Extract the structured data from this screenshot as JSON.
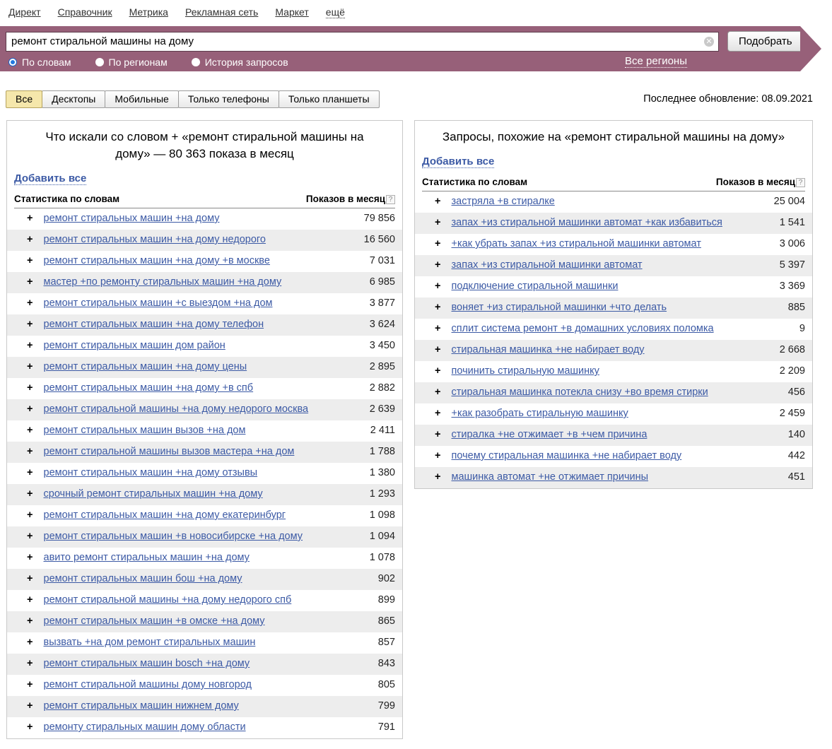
{
  "nav": {
    "items": [
      "Директ",
      "Справочник",
      "Метрика",
      "Рекламная сеть",
      "Маркет"
    ],
    "more_label": "ещё"
  },
  "search": {
    "query": "ремонт стиральной машины на дому",
    "submit_label": "Подобрать",
    "clear_icon": "close-icon",
    "modes": [
      {
        "label": "По словам",
        "selected": true
      },
      {
        "label": "По регионам",
        "selected": false
      },
      {
        "label": "История запросов",
        "selected": false
      }
    ],
    "region_label": "Все регионы"
  },
  "tabs": [
    {
      "label": "Все",
      "selected": true
    },
    {
      "label": "Десктопы",
      "selected": false
    },
    {
      "label": "Мобильные",
      "selected": false
    },
    {
      "label": "Только телефоны",
      "selected": false
    },
    {
      "label": "Только планшеты",
      "selected": false
    }
  ],
  "last_update": "Последнее обновление: 08.09.2021",
  "table_labels": {
    "add_all": "Добавить все",
    "col_keyword": "Статистика по словам",
    "col_count": "Показов в месяц",
    "help_glyph": "?"
  },
  "left_panel": {
    "title": "Что искали со словом + «ремонт стиральной машины на дому» — 80 363 показа в месяц",
    "rows": [
      {
        "query": "ремонт стиральных машин +на дому",
        "count": "79 856"
      },
      {
        "query": "ремонт стиральных машин +на дому недорого",
        "count": "16 560"
      },
      {
        "query": "ремонт стиральных машин +на дому +в москве",
        "count": "7 031"
      },
      {
        "query": "мастер +по ремонту стиральных машин +на дому",
        "count": "6 985"
      },
      {
        "query": "ремонт стиральных машин +с выездом +на дом",
        "count": "3 877"
      },
      {
        "query": "ремонт стиральных машин +на дому телефон",
        "count": "3 624"
      },
      {
        "query": "ремонт стиральных машин дом район",
        "count": "3 450"
      },
      {
        "query": "ремонт стиральных машин +на дому цены",
        "count": "2 895"
      },
      {
        "query": "ремонт стиральных машин +на дому +в спб",
        "count": "2 882"
      },
      {
        "query": "ремонт стиральной машины +на дому недорого москва",
        "count": "2 639"
      },
      {
        "query": "ремонт стиральных машин вызов +на дом",
        "count": "2 411"
      },
      {
        "query": "ремонт стиральной машины вызов мастера +на дом",
        "count": "1 788"
      },
      {
        "query": "ремонт стиральных машин +на дому отзывы",
        "count": "1 380"
      },
      {
        "query": "срочный ремонт стиральных машин +на дому",
        "count": "1 293"
      },
      {
        "query": "ремонт стиральных машин +на дому екатеринбург",
        "count": "1 098"
      },
      {
        "query": "ремонт стиральных машин +в новосибирске +на дому",
        "count": "1 094"
      },
      {
        "query": "авито ремонт стиральных машин +на дому",
        "count": "1 078"
      },
      {
        "query": "ремонт стиральных машин бош +на дому",
        "count": "902"
      },
      {
        "query": "ремонт стиральной машины +на дому недорого спб",
        "count": "899"
      },
      {
        "query": "ремонт стиральных машин +в омске +на дому",
        "count": "865"
      },
      {
        "query": "вызвать +на дом ремонт стиральных машин",
        "count": "857"
      },
      {
        "query": "ремонт стиральных машин bosch +на дому",
        "count": "843"
      },
      {
        "query": "ремонт стиральной машины дому новгород",
        "count": "805"
      },
      {
        "query": "ремонт стиральных машин нижнем дому",
        "count": "799"
      },
      {
        "query": "ремонту стиральных машин дому области",
        "count": "791"
      }
    ]
  },
  "right_panel": {
    "title": "Запросы, похожие на «ремонт стиральной машины на дому»",
    "rows": [
      {
        "query": "застряла +в стиралке",
        "count": "25 004"
      },
      {
        "query": "запах +из стиральной машинки автомат +как избавиться",
        "count": "1 541"
      },
      {
        "query": "+как убрать запах +из стиральной машинки автомат",
        "count": "3 006"
      },
      {
        "query": "запах +из стиральной машинки автомат",
        "count": "5 397"
      },
      {
        "query": "подключение стиральной машинки",
        "count": "3 369"
      },
      {
        "query": "воняет +из стиральной машинки +что делать",
        "count": "885"
      },
      {
        "query": "сплит система ремонт +в домашних условиях поломка",
        "count": "9"
      },
      {
        "query": "стиральная машинка +не набирает воду",
        "count": "2 668"
      },
      {
        "query": "починить стиральную машинку",
        "count": "2 209"
      },
      {
        "query": "стиральная машинка потекла снизу +во время стирки",
        "count": "456"
      },
      {
        "query": "+как разобрать стиральную машинку",
        "count": "2 459"
      },
      {
        "query": "стиралка +не отжимает +в +чем причина",
        "count": "140"
      },
      {
        "query": "почему стиральная машинка +не набирает воду",
        "count": "442"
      },
      {
        "query": "машинка автомат +не отжимает причины",
        "count": "451"
      }
    ]
  },
  "colors": {
    "banner_maroon": "#976079",
    "link_blue": "#3c5aa5",
    "row_alt_gray": "#ededed",
    "tab_selected_bg": "#f5e7ab"
  }
}
